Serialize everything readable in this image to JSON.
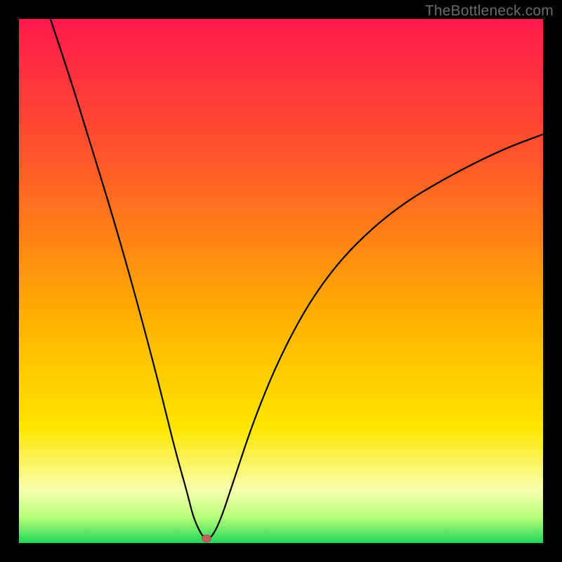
{
  "watermark": {
    "text": "TheBottleneck.com"
  },
  "colors": {
    "background": "#000000",
    "gradient_top": "#ff1a4d",
    "gradient_upper": "#ff5a2a",
    "gradient_mid": "#ffb300",
    "gradient_low1": "#ffe600",
    "gradient_low2": "#f6ffb0",
    "gradient_low3": "#b8ff7a",
    "gradient_bottom": "#1fd65a",
    "curve_stroke": "#000000",
    "marker": "#c0615b"
  },
  "marker": {
    "x_frac": 0.358,
    "y_frac": 0.992
  },
  "chart_data": {
    "type": "line",
    "title": "",
    "xlabel": "",
    "ylabel": "",
    "xlim": [
      0,
      100
    ],
    "ylim": [
      0,
      100
    ],
    "grid": false,
    "legend_position": "none",
    "series": [
      {
        "name": "bottleneck-curve",
        "x": [
          6,
          10,
          14,
          18,
          22,
          26,
          28,
          30,
          32,
          33.5,
          35.8,
          38,
          41,
          45,
          50,
          56,
          63,
          72,
          82,
          92,
          100
        ],
        "y": [
          100,
          88,
          75,
          62,
          48,
          33,
          25,
          17,
          10,
          4,
          0,
          3,
          12,
          24,
          36,
          47,
          56,
          64,
          70,
          75,
          78
        ]
      }
    ],
    "annotations": [
      {
        "name": "optimal-point",
        "x": 35.8,
        "y": 0
      }
    ],
    "notes": "V-shaped bottleneck curve on rainbow gradient; y values read as percent of plot height from bottom; axes and ticks not shown."
  }
}
